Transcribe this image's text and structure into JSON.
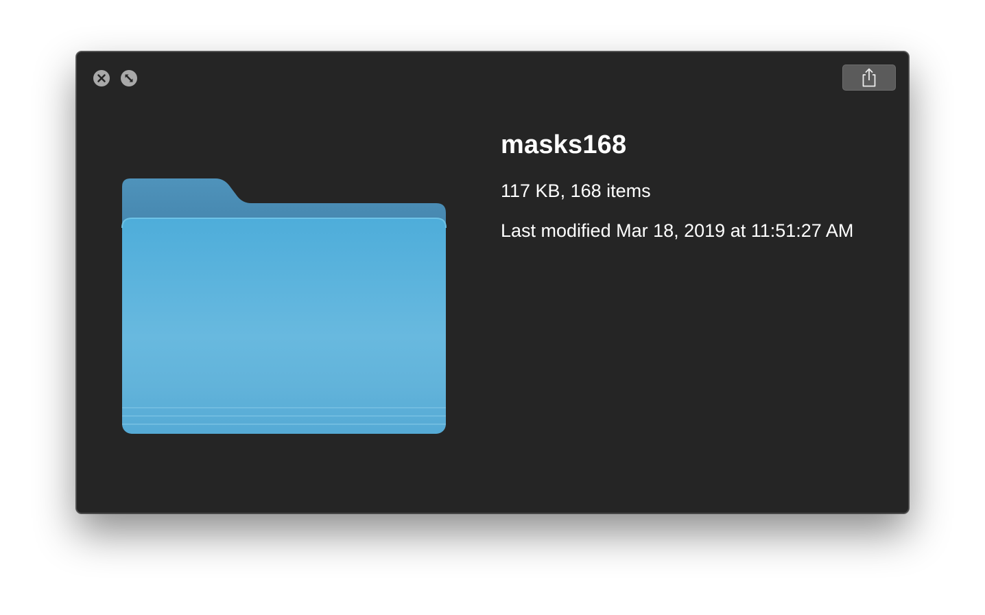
{
  "window": {
    "controls": {
      "close_icon": "close-icon",
      "fullscreen_icon": "fullscreen-icon"
    },
    "share_icon": "share-icon",
    "folder_icon": "folder-icon"
  },
  "file": {
    "name": "masks168",
    "size_and_count": "117 KB, 168 items",
    "modified": "Last modified Mar 18, 2019 at 11:51:27 AM"
  },
  "colors": {
    "window_background": "#252525",
    "folder_front": "#5ab3de",
    "folder_back": "#4a8ab0",
    "control_gray": "#a9a9a9"
  }
}
